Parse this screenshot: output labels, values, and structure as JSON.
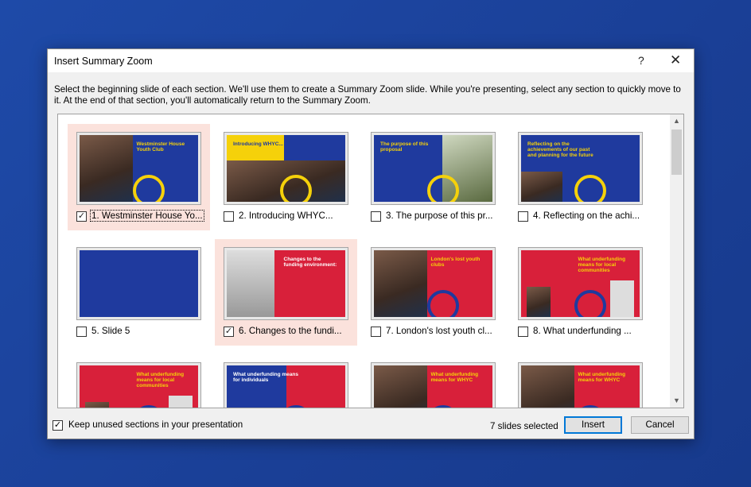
{
  "dialog": {
    "title": "Insert Summary Zoom",
    "help_label": "?",
    "close_label": "✕",
    "instructions": "Select the beginning slide of each section. We'll use them to create a Summary Zoom slide. While you're presenting, select any section to quickly move to it. At the end of that section, you'll automatically return to the Summary Zoom."
  },
  "slides": [
    {
      "label": "1. Westminster House Yo...",
      "checked": true,
      "title": "Westminster House Youth Club",
      "bg": "#1f3a9e",
      "fg": "#f5d10a",
      "style": "photo-left"
    },
    {
      "label": "2. Introducing WHYC...",
      "checked": false,
      "title": "Introducing WHYC...",
      "bg": "#1f3a9e",
      "fg": "#1f3a9e",
      "style": "yellow-top"
    },
    {
      "label": "3. The purpose of this pr...",
      "checked": false,
      "title": "The purpose of this proposal",
      "bg": "#1f3a9e",
      "fg": "#f5d10a",
      "style": "photo-right"
    },
    {
      "label": "4. Reflecting on the achi...",
      "checked": false,
      "title": "Reflecting on the achievements of our past and planning for the future",
      "bg": "#1f3a9e",
      "fg": "#f5d10a",
      "style": "numbers"
    },
    {
      "label": "5. Slide 5",
      "checked": false,
      "title": "",
      "bg": "#1f3a9e",
      "fg": "#fff",
      "style": "blank"
    },
    {
      "label": "6. Changes to the fundi...",
      "checked": true,
      "title": "Changes to the funding environment:",
      "bg": "#d8203a",
      "fg": "#fff",
      "style": "closed"
    },
    {
      "label": "7. London's lost youth cl...",
      "checked": false,
      "title": "London's lost youth clubs",
      "bg": "#d8203a",
      "fg": "#f5d10a",
      "style": "photo-left"
    },
    {
      "label": "8. What underfunding ...",
      "checked": false,
      "title": "What underfunding means for local communities",
      "bg": "#d8203a",
      "fg": "#f5d10a",
      "style": "people"
    },
    {
      "label": "",
      "checked": false,
      "title": "What underfunding means for local communities",
      "bg": "#d8203a",
      "fg": "#f5d10a",
      "style": "people"
    },
    {
      "label": "",
      "checked": false,
      "title": "What underfunding means for individuals",
      "bg": "#d8203a",
      "fg": "#fff",
      "style": "blue-left"
    },
    {
      "label": "",
      "checked": false,
      "title": "What underfunding means for WHYC",
      "bg": "#d8203a",
      "fg": "#f5d10a",
      "style": "photo-left"
    },
    {
      "label": "",
      "checked": false,
      "title": "What underfunding means for WHYC",
      "bg": "#d8203a",
      "fg": "#f5d10a",
      "style": "photo-left"
    }
  ],
  "footer": {
    "keep_label": "Keep unused sections in your presentation",
    "keep_checked": true,
    "selected_count": "7 slides selected",
    "insert_label": "Insert",
    "cancel_label": "Cancel"
  }
}
